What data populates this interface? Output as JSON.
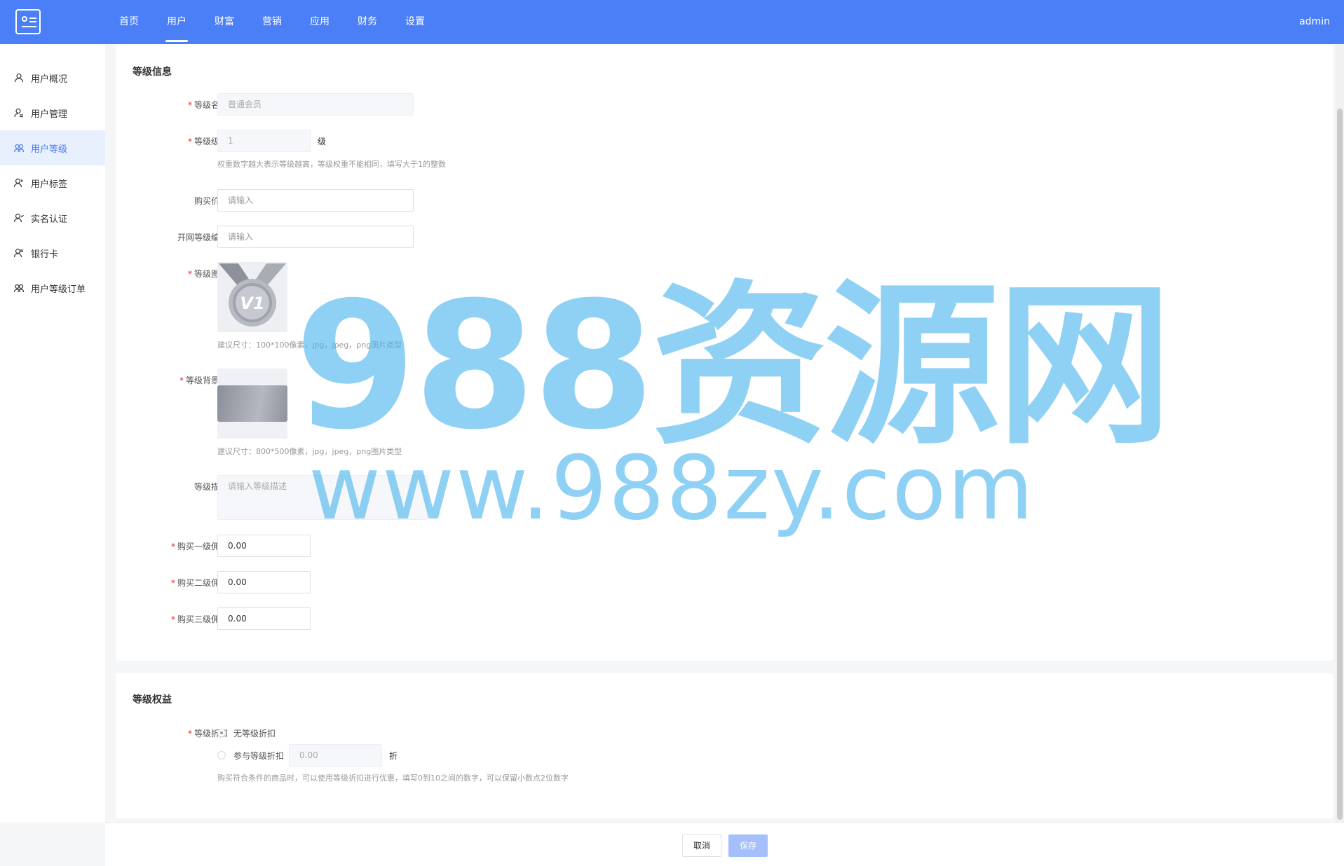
{
  "header": {
    "nav": [
      "首页",
      "用户",
      "财富",
      "营销",
      "应用",
      "财务",
      "设置"
    ],
    "active_nav": 1,
    "user": "admin"
  },
  "sidebar": {
    "items": [
      {
        "label": "用户概况",
        "icon": "user-icon"
      },
      {
        "label": "用户管理",
        "icon": "user-manage-icon"
      },
      {
        "label": "用户等级",
        "icon": "users-icon"
      },
      {
        "label": "用户标签",
        "icon": "user-tag-icon"
      },
      {
        "label": "实名认证",
        "icon": "user-verify-icon"
      },
      {
        "label": "银行卡",
        "icon": "bank-card-icon"
      },
      {
        "label": "用户等级订单",
        "icon": "users-order-icon"
      }
    ],
    "active_index": 2,
    "accent_color": "#4a7ff7"
  },
  "level_info": {
    "title": "等级信息",
    "name": {
      "label": "等级名称",
      "value": "普通会员"
    },
    "level": {
      "label": "等级级别",
      "value": "1",
      "unit": "级",
      "hint": "权重数字越大表示等级越高，等级权重不能相同，填写大于1的整数"
    },
    "price": {
      "label": "购买价格",
      "placeholder": "请输入"
    },
    "code": {
      "label": "开网等级编号",
      "placeholder": "请输入"
    },
    "icon": {
      "label": "等级图标",
      "badge_text": "V1",
      "hint": "建议尺寸：100*100像素，jpg，jpeg，png图片类型"
    },
    "background": {
      "label": "等级背景图",
      "hint": "建议尺寸：800*500像素，jpg，jpeg，png图片类型"
    },
    "description": {
      "label": "等级描述",
      "placeholder": "请输入等级描述"
    },
    "commission1": {
      "label": "购买一级佣金",
      "value": "0.00"
    },
    "commission2": {
      "label": "购买二级佣金",
      "value": "0.00"
    },
    "commission3": {
      "label": "购买三级佣金",
      "value": "0.00"
    }
  },
  "benefits": {
    "title": "等级权益",
    "discount": {
      "label": "等级折扣",
      "option_none": "无等级折扣",
      "option_join": "参与等级折扣",
      "value": "0.00",
      "unit": "折",
      "hint": "购买符合条件的商品时，可以使用等级折扣进行优惠，填写0到10之间的数字，可以保留小数点2位数字"
    }
  },
  "footer": {
    "cancel": "取消",
    "save": "保存"
  },
  "watermark": {
    "line1": "988资源网",
    "line2": "www.988zy.com"
  },
  "colors": {
    "header": "#4a7ff7",
    "required": "#f5222d",
    "save_button": "#a4bff9"
  }
}
